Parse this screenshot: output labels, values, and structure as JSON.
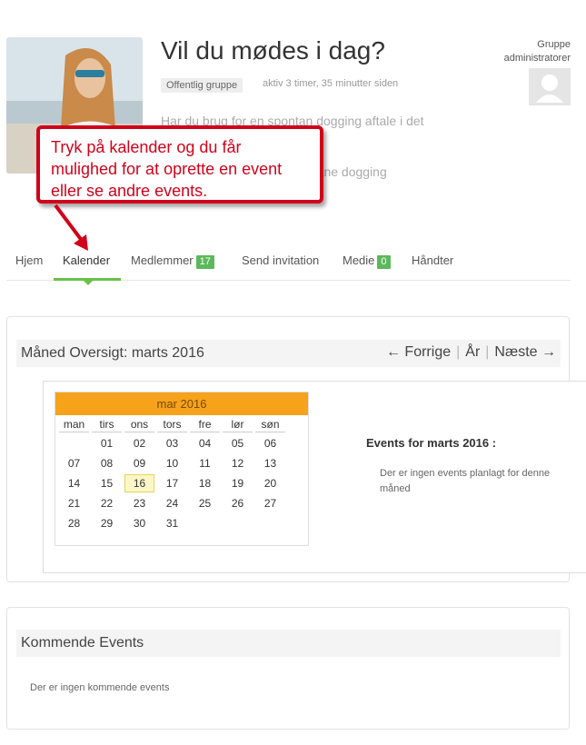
{
  "group": {
    "title": "Vil du mødes i dag?",
    "badge": "Offentlig gruppe",
    "active": "aktiv 3 timer, 35 minutter siden",
    "desc_line1": "Har du brug for en spontan dogging aftale i det",
    "desc_line2": "ntane dogging",
    "admin_label": "Gruppe administratorer"
  },
  "callout": {
    "text": "Tryk på kalender og du får mulighed for at oprette en event eller se andre events."
  },
  "tabs": [
    {
      "label": "Hjem"
    },
    {
      "label": "Kalender"
    },
    {
      "label": "Medlemmer",
      "count": "17"
    },
    {
      "label": "Send invitation"
    },
    {
      "label": "Medie",
      "count": "0"
    },
    {
      "label": "Håndter"
    }
  ],
  "calendar": {
    "heading": "Måned Oversigt: marts 2016",
    "nav_prev": "← Forrige",
    "nav_year": "År",
    "nav_next": "Næste →",
    "month_label": "mar 2016",
    "weekdays": [
      "man",
      "tirs",
      "ons",
      "tors",
      "fre",
      "lør",
      "søn"
    ],
    "weeks": [
      [
        "",
        "01",
        "02",
        "03",
        "04",
        "05",
        "06"
      ],
      [
        "07",
        "08",
        "09",
        "10",
        "11",
        "12",
        "13"
      ],
      [
        "14",
        "15",
        "16",
        "17",
        "18",
        "19",
        "20"
      ],
      [
        "21",
        "22",
        "23",
        "24",
        "25",
        "26",
        "27"
      ],
      [
        "28",
        "29",
        "30",
        "31",
        "",
        "",
        ""
      ]
    ],
    "today": "16",
    "events_title": "Events for marts 2016 :",
    "events_none": "Der er ingen events planlagt for denne måned"
  },
  "upcoming": {
    "title": "Kommende Events",
    "none": "Der er ingen kommende events"
  },
  "colors": {
    "accent_green": "#6cc04a",
    "count_green": "#5cb85c",
    "calendar_orange": "#f7a21b",
    "callout_red": "#d0021b"
  }
}
